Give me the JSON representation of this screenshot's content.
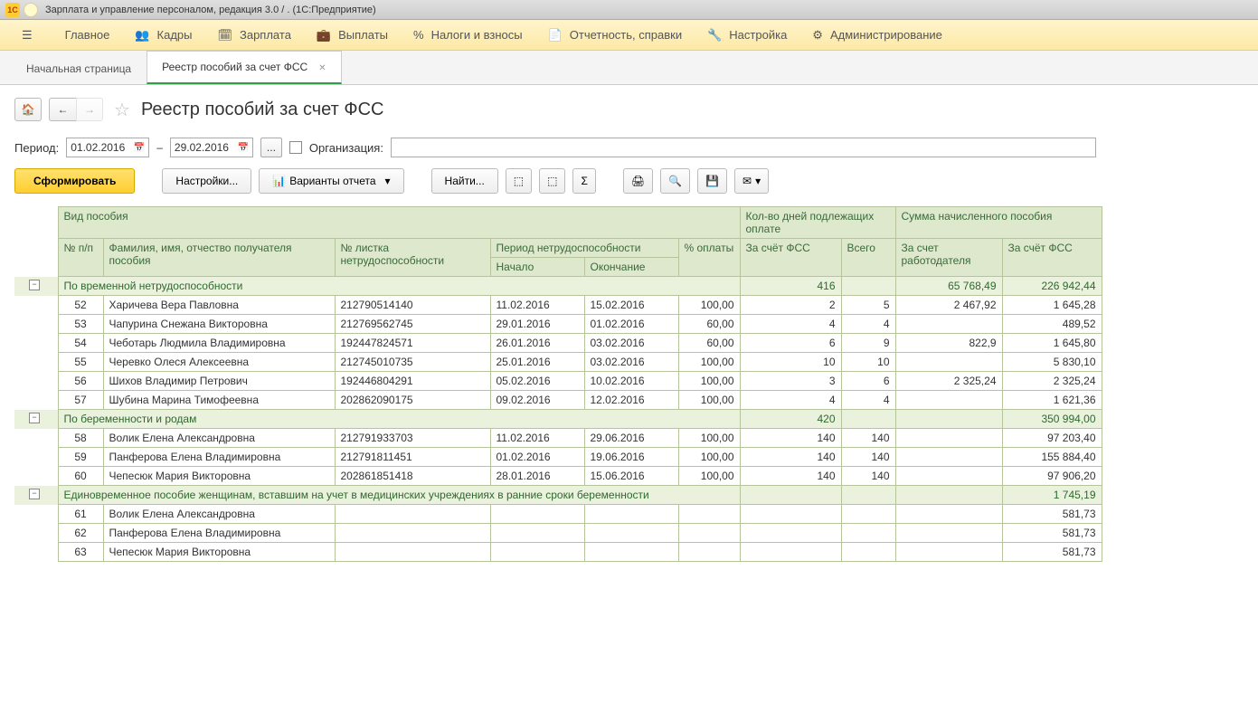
{
  "window": {
    "title": "Зарплата и управление персоналом, редакция 3.0 /                                    . (1С:Предприятие)"
  },
  "menu": [
    {
      "label": "Главное"
    },
    {
      "label": "Кадры"
    },
    {
      "label": "Зарплата"
    },
    {
      "label": "Выплаты"
    },
    {
      "label": "Налоги и взносы"
    },
    {
      "label": "Отчетность, справки"
    },
    {
      "label": "Настройка"
    },
    {
      "label": "Администрирование"
    }
  ],
  "tabs": [
    {
      "label": "Начальная страница",
      "active": false
    },
    {
      "label": "Реестр пособий за счет ФСС",
      "active": true
    }
  ],
  "page": {
    "title": "Реестр пособий за счет ФСС"
  },
  "filter": {
    "period_label": "Период:",
    "date_from": "01.02.2016",
    "dash": "–",
    "date_to": "29.02.2016",
    "dots": "...",
    "org_label": "Организация:"
  },
  "toolbar": {
    "form": "Сформировать",
    "settings": "Настройки...",
    "variants": "Варианты отчета",
    "find": "Найти..."
  },
  "headers": {
    "vid": "Вид пособия",
    "days": "Кол-во дней подлежащих оплате",
    "sum": "Сумма начисленного пособия",
    "np": "№ п/п",
    "fio": "Фамилия, имя, отчество получателя пособия",
    "list": "№ листка нетрудоспособности",
    "period": "Период нетрудоспособности",
    "pct": "% оплаты",
    "fss": "За счёт ФСС",
    "total": "Всего",
    "emp": "За счет работодателя",
    "fss2": "За счёт ФСС",
    "start": "Начало",
    "end": "Окончание"
  },
  "groups": [
    {
      "title": "По временной нетрудоспособности",
      "days_fss": "416",
      "sum_emp": "65 768,49",
      "sum_fss": "226 942,44",
      "rows": [
        {
          "n": "52",
          "fio": "Харичева Вера  Павловна",
          "list": "212790514140",
          "start": "11.02.2016",
          "end": "15.02.2016",
          "pct": "100,00",
          "dfss": "2",
          "dtot": "5",
          "semp": "2 467,92",
          "sfss": "1 645,28"
        },
        {
          "n": "53",
          "fio": "Чапурина Снежана Викторовна",
          "list": "212769562745",
          "start": "29.01.2016",
          "end": "01.02.2016",
          "pct": "60,00",
          "dfss": "4",
          "dtot": "4",
          "semp": "",
          "sfss": "489,52"
        },
        {
          "n": "54",
          "fio": "Чеботарь Людмила Владимировна",
          "list": "192447824571",
          "start": "26.01.2016",
          "end": "03.02.2016",
          "pct": "60,00",
          "dfss": "6",
          "dtot": "9",
          "semp": "822,9",
          "sfss": "1 645,80"
        },
        {
          "n": "55",
          "fio": "Черевко Олеся Алексеевна",
          "list": "212745010735",
          "start": "25.01.2016",
          "end": "03.02.2016",
          "pct": "100,00",
          "dfss": "10",
          "dtot": "10",
          "semp": "",
          "sfss": "5 830,10"
        },
        {
          "n": "56",
          "fio": "Шихов Владимир Петрович",
          "list": "192446804291",
          "start": "05.02.2016",
          "end": "10.02.2016",
          "pct": "100,00",
          "dfss": "3",
          "dtot": "6",
          "semp": "2 325,24",
          "sfss": "2 325,24"
        },
        {
          "n": "57",
          "fio": "Шубина Марина Тимофеевна",
          "list": "202862090175",
          "start": "09.02.2016",
          "end": "12.02.2016",
          "pct": "100,00",
          "dfss": "4",
          "dtot": "4",
          "semp": "",
          "sfss": "1 621,36"
        }
      ]
    },
    {
      "title": "По беременности и родам",
      "days_fss": "420",
      "sum_emp": "",
      "sum_fss": "350 994,00",
      "rows": [
        {
          "n": "58",
          "fio": "Волик Елена Александровна",
          "list": "212791933703",
          "start": "11.02.2016",
          "end": "29.06.2016",
          "pct": "100,00",
          "dfss": "140",
          "dtot": "140",
          "semp": "",
          "sfss": "97 203,40"
        },
        {
          "n": "59",
          "fio": "Панферова Елена Владимировна",
          "list": "212791811451",
          "start": "01.02.2016",
          "end": "19.06.2016",
          "pct": "100,00",
          "dfss": "140",
          "dtot": "140",
          "semp": "",
          "sfss": "155 884,40"
        },
        {
          "n": "60",
          "fio": "Чепесюк Мария Викторовна",
          "list": "202861851418",
          "start": "28.01.2016",
          "end": "15.06.2016",
          "pct": "100,00",
          "dfss": "140",
          "dtot": "140",
          "semp": "",
          "sfss": "97 906,20"
        }
      ]
    },
    {
      "title": "Единовременное пособие женщинам, вставшим на учет в медицинских учреждениях в ранние сроки беременности",
      "days_fss": "",
      "sum_emp": "",
      "sum_fss": "1 745,19",
      "rows": [
        {
          "n": "61",
          "fio": "Волик Елена Александровна",
          "list": "",
          "start": "",
          "end": "",
          "pct": "",
          "dfss": "",
          "dtot": "",
          "semp": "",
          "sfss": "581,73"
        },
        {
          "n": "62",
          "fio": "Панферова Елена Владимировна",
          "list": "",
          "start": "",
          "end": "",
          "pct": "",
          "dfss": "",
          "dtot": "",
          "semp": "",
          "sfss": "581,73"
        },
        {
          "n": "63",
          "fio": "Чепесюк Мария Викторовна",
          "list": "",
          "start": "",
          "end": "",
          "pct": "",
          "dfss": "",
          "dtot": "",
          "semp": "",
          "sfss": "581,73"
        }
      ]
    }
  ]
}
